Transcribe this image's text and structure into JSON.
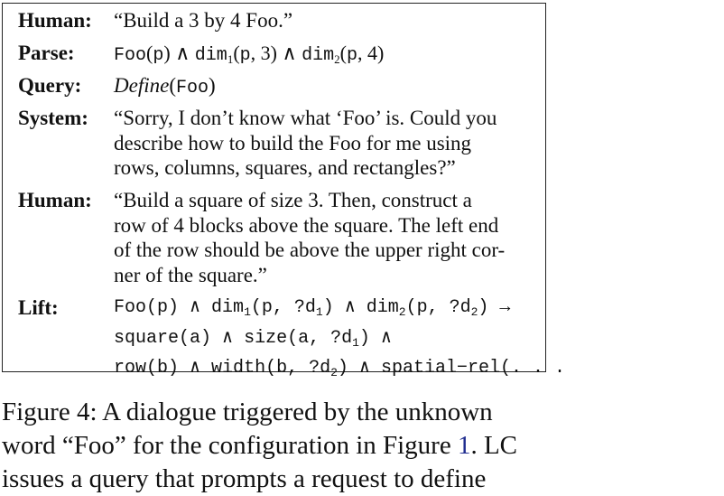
{
  "dialogue": {
    "human1": {
      "label": "Human:",
      "text": "“Build a 3 by 4 Foo.”"
    },
    "parse": {
      "label": "Parse:",
      "foo": "Foo",
      "p": "p",
      "and": " ∧ ",
      "dim": "dim",
      "sub1": "1",
      "sub2": "2",
      "n3": "3",
      "n4": "4"
    },
    "query": {
      "label": "Query:",
      "define": "Define",
      "foo": "Foo"
    },
    "system": {
      "label": "System:",
      "lines": [
        "“Sorry, I don’t know what ‘Foo’ is. Could you",
        "describe how to build the Foo for me using",
        "rows, columns, squares, and rectangles?”"
      ]
    },
    "human2": {
      "label": "Human:",
      "lines": [
        "“Build a square of size 3.  Then, construct a",
        "row of 4 blocks above the square. The left end",
        "of the row should be above the upper right cor-",
        "ner of the square.”"
      ]
    },
    "lift": {
      "label": "Lift:",
      "line1_a": "Foo(p) ∧ dim",
      "line1_sub1": "1",
      "line1_b": "(p, ?d",
      "line1_sub1b": "1",
      "line1_c": ") ∧ dim",
      "line1_sub2": "2",
      "line1_d": "(p, ?d",
      "line1_sub2b": "2",
      "line1_e": ") →",
      "line2_a": "square(a) ∧ size(a, ?d",
      "line2_sub": "1",
      "line2_b": ") ∧",
      "line3_a": "row(b) ∧ width(b, ?d",
      "line3_sub": "2",
      "line3_b": ")  ∧ spatial−rel(. . ."
    }
  },
  "caption": {
    "line1": "Figure 4:  A dialogue triggered by the unknown",
    "line2_a": "word “Foo” for the configuration in Figure ",
    "line2_ref": "1",
    "line2_b": ".  LC",
    "line3": "issues a query that prompts a request to define"
  }
}
